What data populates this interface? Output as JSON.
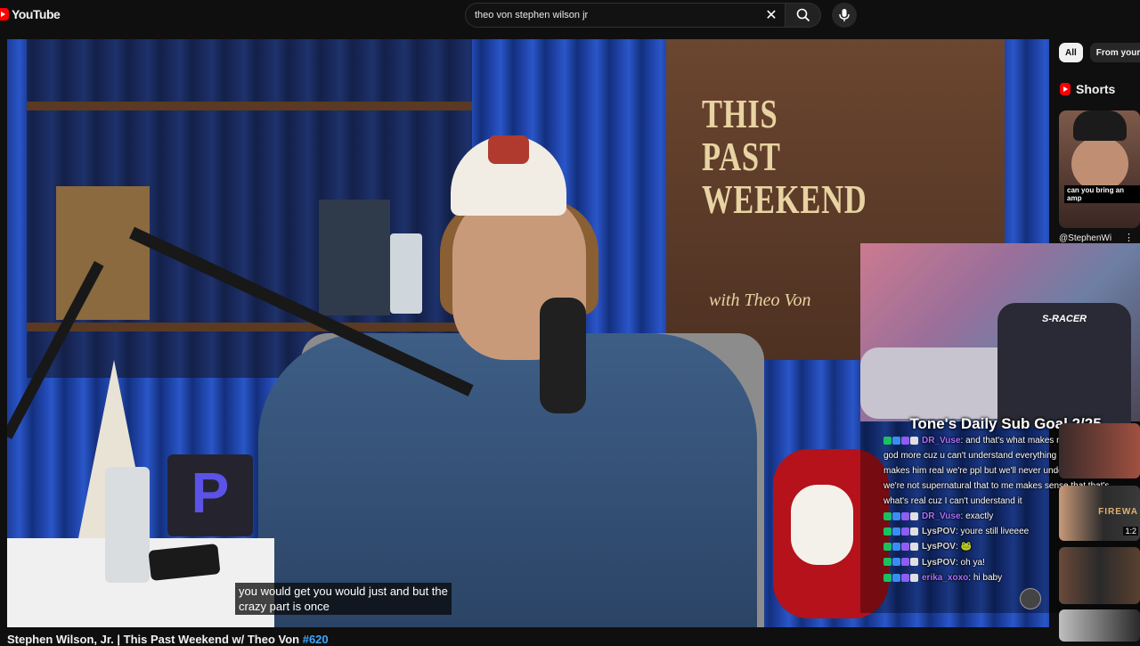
{
  "header": {
    "logo_text": "YouTube",
    "search_value": "theo von stephen wilson jr",
    "icons": [
      "youtube-logo-icon",
      "close-icon",
      "search-icon",
      "microphone-icon"
    ]
  },
  "player": {
    "sign_lines": [
      "THIS",
      "PAST",
      "WEEKEND"
    ],
    "sign_script": "with Theo Von",
    "subtitle_line1": "you would get you would just and but the",
    "subtitle_line2": "crazy part is once",
    "box_letter": "P",
    "chair_brand": "S-RACER",
    "overlay_goal": "Tone's Daily Sub Goal 2/25",
    "chat": [
      {
        "user": "DR_Vuse",
        "user_color": "#a970ff",
        "message": ": and that's what makes me believe in god more cuz u can't understand everything and that's what makes him real we're ppl but we'll never understand god bc we're not supernatural that to me makes sense that that's what's real cuz I can't understand it"
      },
      {
        "user": "DR_Vuse",
        "user_color": "#a970ff",
        "message": ": exactly"
      },
      {
        "user": "LysPOV",
        "user_color": "#d8d8d8",
        "message": ": youre still liveeee"
      },
      {
        "user": "LysPOV",
        "user_color": "#d8d8d8",
        "message": ": 🐸"
      },
      {
        "user": "LysPOV",
        "user_color": "#d8d8d8",
        "message": ": oh ya!"
      },
      {
        "user": "erika_xoxo",
        "user_color": "#a970ff",
        "message": ": hi baby"
      }
    ]
  },
  "sidebar": {
    "chips": [
      {
        "label": "All",
        "active": true
      },
      {
        "label": "From your s",
        "active": false
      }
    ],
    "shorts_title": "Shorts",
    "short": {
      "caption": "can you bring an amp",
      "channel": "@StephenWi",
      "menu": "⋮"
    },
    "thumbs": [
      {
        "text": "",
        "duration": ""
      },
      {
        "text": "FIREWA",
        "duration": "1:2"
      },
      {
        "text": "",
        "duration": ""
      },
      {
        "text": "",
        "duration": ""
      }
    ]
  },
  "video": {
    "title": "Stephen Wilson, Jr. | This Past Weekend w/ Theo Von ",
    "tag": "#620"
  },
  "colors": {
    "background": "#0f0f0f",
    "accent_red": "#ff0000",
    "link_blue": "#3ea6ff"
  }
}
